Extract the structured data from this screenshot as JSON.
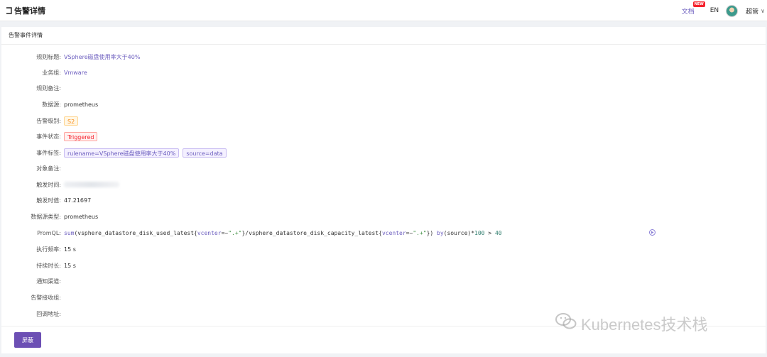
{
  "header": {
    "title": "告警详情",
    "docs_label": "文档",
    "docs_badge": "NEW",
    "lang": "EN",
    "username": "超管",
    "caret": "∨"
  },
  "card": {
    "title": "告警事件详情",
    "fields": {
      "rule_title": {
        "label": "规则标题:",
        "value": "VSphere磁盘使用率大于40%"
      },
      "business_group": {
        "label": "业务组:",
        "value": "Vmware"
      },
      "rule_note": {
        "label": "规则备注:",
        "value": ""
      },
      "datasource": {
        "label": "数据源:",
        "value": "prometheus"
      },
      "severity": {
        "label": "告警级别:",
        "value": "S2"
      },
      "status": {
        "label": "事件状态:",
        "value": "Triggered"
      },
      "tags": {
        "label": "事件标签:",
        "values": [
          "rulename=VSphere磁盘使用率大于40%",
          "source=data"
        ]
      },
      "target_note": {
        "label": "对象备注:",
        "value": ""
      },
      "trigger_time": {
        "label": "触发时间:",
        "value": ""
      },
      "trigger_value": {
        "label": "触发时值:",
        "value": "47.21697"
      },
      "datasource_type": {
        "label": "数据源类型:",
        "value": "prometheus"
      },
      "promql": {
        "label": "PromQL:",
        "parts": {
          "p1": "sum",
          "p2": "(vsphere_datastore_disk_used_latest{",
          "p3": "vcenter",
          "p4": "=~",
          "p5": "\".+\"",
          "p6": "}/vsphere_datastore_disk_capacity_latest{",
          "p7": "vcenter",
          "p8": "=~",
          "p9": "\".+\"",
          "p10": "}) ",
          "p11": "by",
          "p12": "(source)*",
          "p13": "100",
          "p14": " > ",
          "p15": "40"
        }
      },
      "eval_interval": {
        "label": "执行频率:",
        "value": "15 s"
      },
      "duration": {
        "label": "持续时长:",
        "value": "15 s"
      },
      "notify_channels": {
        "label": "通知渠道:",
        "value": ""
      },
      "notify_groups": {
        "label": "告警接收组:",
        "value": ""
      },
      "callback": {
        "label": "回调地址:",
        "value": ""
      }
    },
    "mute_button": "屏蔽"
  },
  "watermark": "Kubernetes技术栈",
  "colors": {
    "accent": "#6c5ebf",
    "button": "#6c4fb4",
    "status_red": "#f5222d",
    "level_orange": "#fa8c16"
  }
}
